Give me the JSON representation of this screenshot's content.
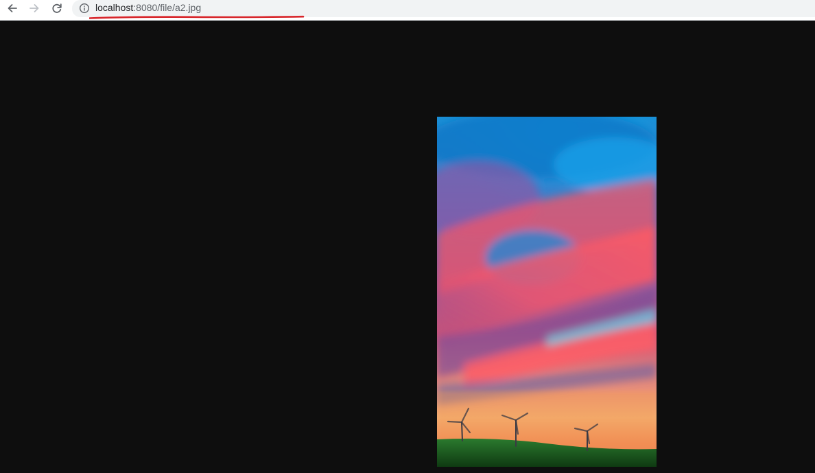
{
  "toolbar": {
    "back_icon": "arrow-left-icon",
    "forward_icon": "arrow-right-icon",
    "reload_icon": "reload-icon"
  },
  "omnibox": {
    "security_icon": "info-icon",
    "url_host": "localhost",
    "url_rest": ":8080/file/a2.jpg",
    "annotation_color": "#d8262b"
  },
  "viewer": {
    "background": "#0e0e0e",
    "image": {
      "file": "a2.jpg",
      "subject": "sunset sky with wind turbines"
    }
  }
}
